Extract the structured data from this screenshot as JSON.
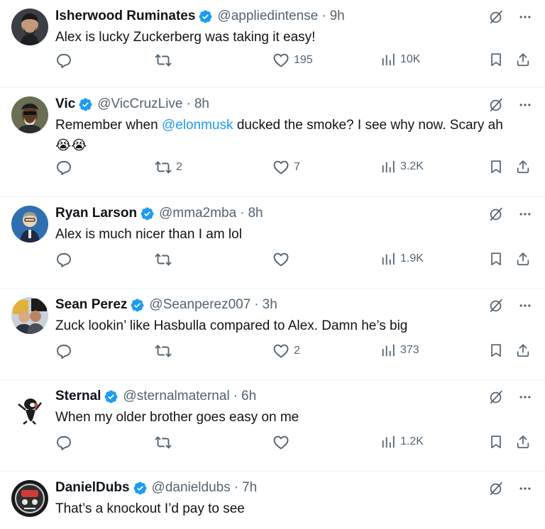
{
  "tweets": [
    {
      "name": "Isherwood Ruminates",
      "handle": "@appliedintense",
      "dot": "·",
      "time": "9h",
      "text": "Alex is lucky Zuckerberg was taking it easy!",
      "replies": "",
      "retweets": "",
      "likes": "195",
      "views": "10K"
    },
    {
      "name": "Vic",
      "handle": "@VicCruzLive",
      "dot": "·",
      "time": "8h",
      "text_before": "Remember when ",
      "mention": "@elonmusk",
      "text_after": " ducked the smoke? I see why now. Scary ah",
      "emojis": "😭😭",
      "replies": "",
      "retweets": "2",
      "likes": "7",
      "views": "3.2K"
    },
    {
      "name": "Ryan Larson",
      "handle": "@mma2mba",
      "dot": "·",
      "time": "8h",
      "text": "Alex is much nicer than I am lol",
      "replies": "",
      "retweets": "",
      "likes": "",
      "views": "1.9K"
    },
    {
      "name": "Sean Perez",
      "handle": "@Seanperez007",
      "dot": "·",
      "time": "3h",
      "text": "Zuck lookin’ like Hasbulla compared to Alex. Damn he’s big",
      "replies": "",
      "retweets": "",
      "likes": "2",
      "views": "373"
    },
    {
      "name": "Sternal",
      "handle": "@sternalmaternal",
      "dot": "·",
      "time": "6h",
      "text": "When my older brother goes easy on me",
      "replies": "",
      "retweets": "",
      "likes": "",
      "views": "1.2K"
    },
    {
      "name": "DanielDubs",
      "handle": "@danieldubs",
      "dot": "·",
      "time": "7h",
      "text": "That’s a knockout I’d pay to see"
    }
  ],
  "icons": {
    "reply": "reply-icon",
    "retweet": "retweet-icon",
    "like": "like-icon",
    "views": "views-icon",
    "bookmark": "bookmark-icon",
    "share": "share-icon",
    "grok": "grok-icon",
    "more": "more-icon",
    "verified": "verified-badge-icon"
  },
  "colors": {
    "text": "#0f1419",
    "muted": "#536471",
    "link": "#1d9bf0",
    "verified": "#1d9bf0",
    "divider": "#eff3f4"
  }
}
